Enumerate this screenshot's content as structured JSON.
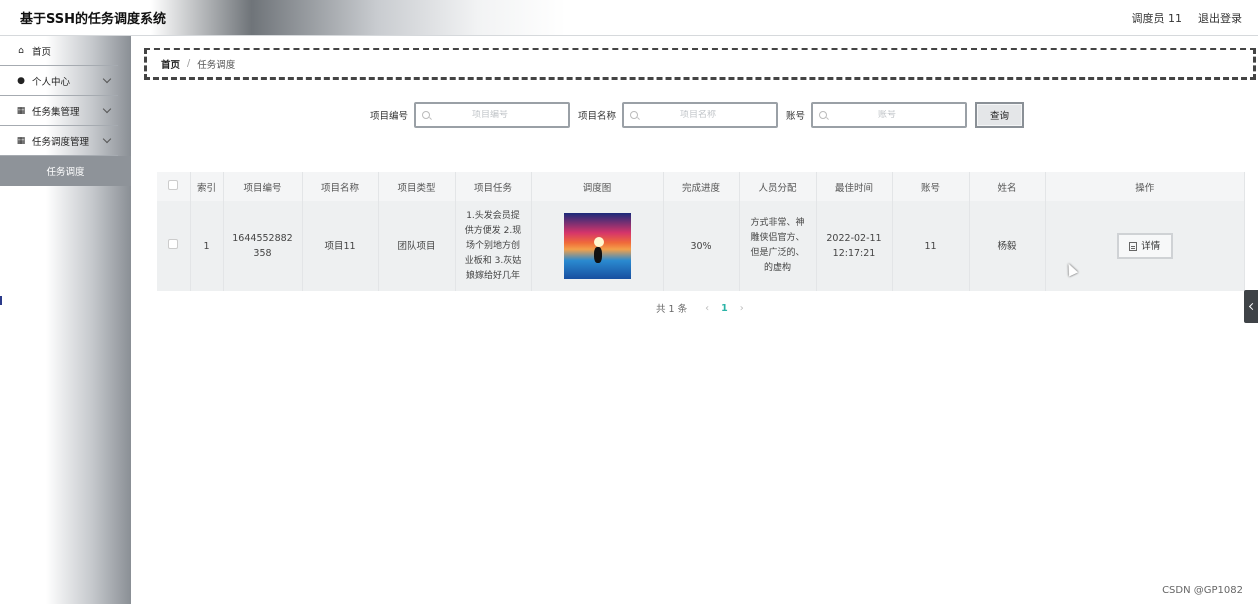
{
  "header": {
    "title": "基于SSH的任务调度系统",
    "user": "调度员 11",
    "logout": "退出登录"
  },
  "sidebar": {
    "items": [
      {
        "label": "首页",
        "icon": "home-icon"
      },
      {
        "label": "个人中心",
        "icon": "user-icon"
      },
      {
        "label": "任务集管理",
        "icon": "grid-icon"
      },
      {
        "label": "任务调度管理",
        "icon": "grid-icon"
      }
    ],
    "active_sub": "任务调度"
  },
  "breadcrumb": {
    "home": "首页",
    "separator": "/",
    "current": "任务调度"
  },
  "search": {
    "project_no_label": "项目编号",
    "project_no_placeholder": "项目编号",
    "project_name_label": "项目名称",
    "project_name_placeholder": "项目名称",
    "account_label": "账号",
    "account_placeholder": "账号",
    "query_button": "查询"
  },
  "table": {
    "headers": [
      "索引",
      "项目编号",
      "项目名称",
      "项目类型",
      "项目任务",
      "调度图",
      "完成进度",
      "人员分配",
      "最佳时间",
      "账号",
      "姓名",
      "操作"
    ],
    "rows": [
      {
        "index": "1",
        "project_no": "1644552882358",
        "project_name": "项目11",
        "project_type": "团队项目",
        "project_task": "1.头发会员提供方便发 2.现场个别地方创业板和 3.灰姑娘嫁给好几年",
        "progress": "30%",
        "staff": "方式非常、神雕侠侣官方、但是广泛的、的虚构",
        "best_time": "2022-02-11 12:17:21",
        "account": "11",
        "name": "杨毅",
        "action": "详情"
      }
    ]
  },
  "pagination": {
    "total": "共 1 条",
    "current_page": "1"
  },
  "watermark": "CSDN @GP1082"
}
